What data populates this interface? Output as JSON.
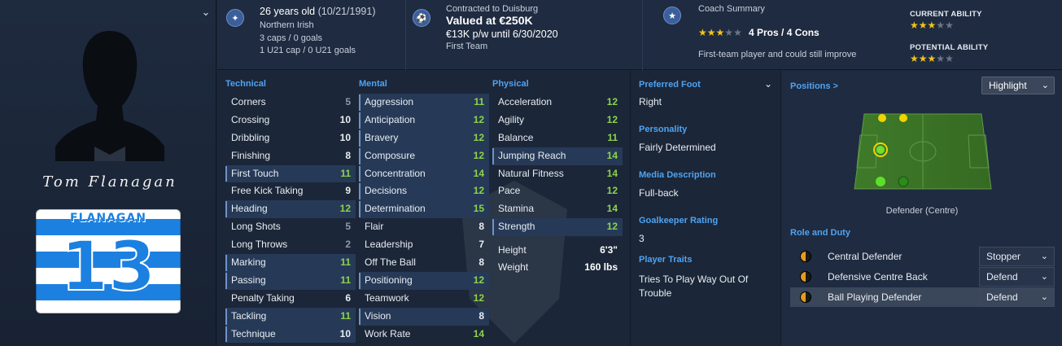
{
  "player": {
    "signature": "Tom Flanagan",
    "shirt_name": "FLANAGAN",
    "shirt_number": "13"
  },
  "header": {
    "age": "26 years old",
    "dob": "(10/21/1991)",
    "nationality": "Northern Irish",
    "caps": "3 caps / 0 goals",
    "u21_caps": "1 U21 cap / 0 U21 goals",
    "contract_label": "Contracted to Duisburg",
    "value": "Valued at €250K",
    "wage": "€13K p/w until 6/30/2020",
    "squad_status": "First Team",
    "coach_title": "Coach Summary",
    "pros_cons": "4 Pros / 4 Cons",
    "coach_summary": "First-team player and could still improve",
    "current_ability_label": "CURRENT ABILITY",
    "potential_ability_label": "POTENTIAL ABILITY",
    "coach_stars": 3,
    "current_ability_stars": 3,
    "potential_ability_stars": 3,
    "star_color": "#f0c419"
  },
  "attributes": {
    "technical": {
      "title": "Technical",
      "items": [
        {
          "label": "Corners",
          "value": "5"
        },
        {
          "label": "Crossing",
          "value": "10"
        },
        {
          "label": "Dribbling",
          "value": "10"
        },
        {
          "label": "Finishing",
          "value": "8"
        },
        {
          "label": "First Touch",
          "value": "11"
        },
        {
          "label": "Free Kick Taking",
          "value": "9"
        },
        {
          "label": "Heading",
          "value": "12"
        },
        {
          "label": "Long Shots",
          "value": "5"
        },
        {
          "label": "Long Throws",
          "value": "2"
        },
        {
          "label": "Marking",
          "value": "11"
        },
        {
          "label": "Passing",
          "value": "11"
        },
        {
          "label": "Penalty Taking",
          "value": "6"
        },
        {
          "label": "Tackling",
          "value": "11"
        },
        {
          "label": "Technique",
          "value": "10"
        }
      ]
    },
    "mental": {
      "title": "Mental",
      "items": [
        {
          "label": "Aggression",
          "value": "11"
        },
        {
          "label": "Anticipation",
          "value": "12"
        },
        {
          "label": "Bravery",
          "value": "12"
        },
        {
          "label": "Composure",
          "value": "12"
        },
        {
          "label": "Concentration",
          "value": "14"
        },
        {
          "label": "Decisions",
          "value": "12"
        },
        {
          "label": "Determination",
          "value": "15"
        },
        {
          "label": "Flair",
          "value": "8"
        },
        {
          "label": "Leadership",
          "value": "7"
        },
        {
          "label": "Off The Ball",
          "value": "8"
        },
        {
          "label": "Positioning",
          "value": "12"
        },
        {
          "label": "Teamwork",
          "value": "12"
        },
        {
          "label": "Vision",
          "value": "8"
        },
        {
          "label": "Work Rate",
          "value": "14"
        }
      ]
    },
    "physical": {
      "title": "Physical",
      "items": [
        {
          "label": "Acceleration",
          "value": "12"
        },
        {
          "label": "Agility",
          "value": "12"
        },
        {
          "label": "Balance",
          "value": "11"
        },
        {
          "label": "Jumping Reach",
          "value": "14"
        },
        {
          "label": "Natural Fitness",
          "value": "14"
        },
        {
          "label": "Pace",
          "value": "12"
        },
        {
          "label": "Stamina",
          "value": "14"
        },
        {
          "label": "Strength",
          "value": "12"
        }
      ]
    },
    "height_label": "Height",
    "height_value": "6'3\"",
    "weight_label": "Weight",
    "weight_value": "160 lbs"
  },
  "info": {
    "preferred_foot_label": "Preferred Foot",
    "preferred_foot": "Right",
    "personality_label": "Personality",
    "personality": "Fairly Determined",
    "media_label": "Media Description",
    "media": "Full-back",
    "gk_rating_label": "Goalkeeper Rating",
    "gk_rating": "3",
    "traits_label": "Player Traits",
    "traits": "Tries To Play Way Out Of Trouble"
  },
  "positions": {
    "title": "Positions >",
    "highlight_label": "Highlight",
    "caption": "Defender (Centre)",
    "role_title": "Role and Duty",
    "roles": [
      {
        "name": "Central Defender",
        "duty": "Stopper"
      },
      {
        "name": "Defensive Centre Back",
        "duty": "Defend"
      },
      {
        "name": "Ball Playing Defender",
        "duty": "Defend"
      }
    ]
  }
}
